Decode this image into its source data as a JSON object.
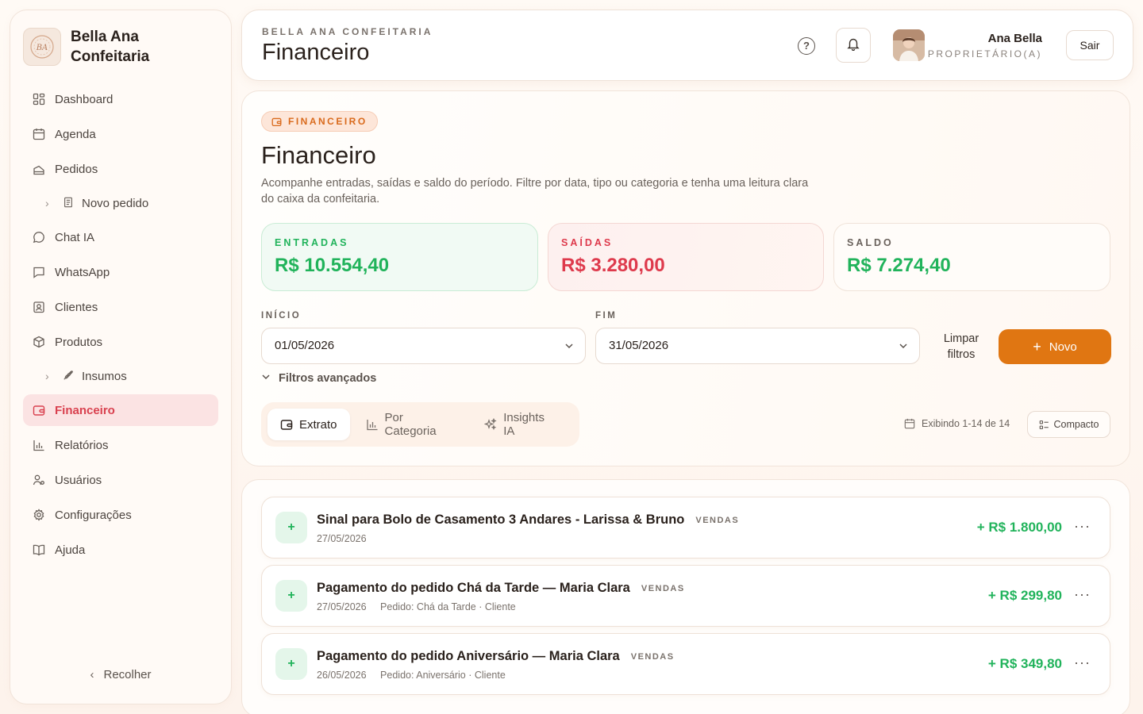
{
  "brand": {
    "name_line1": "Bella Ana",
    "name_line2": "Confeitaria"
  },
  "sidebar": {
    "items": [
      {
        "label": "Dashboard",
        "icon": "dashboard-icon"
      },
      {
        "label": "Agenda",
        "icon": "calendar-icon"
      },
      {
        "label": "Pedidos",
        "icon": "cake-icon"
      },
      {
        "label": "Novo pedido",
        "icon": "document-icon",
        "sub": true
      },
      {
        "label": "Chat IA",
        "icon": "chat-icon"
      },
      {
        "label": "WhatsApp",
        "icon": "message-icon"
      },
      {
        "label": "Clientes",
        "icon": "contact-icon"
      },
      {
        "label": "Produtos",
        "icon": "package-icon"
      },
      {
        "label": "Insumos",
        "icon": "wheat-icon",
        "sub": true
      },
      {
        "label": "Financeiro",
        "icon": "wallet-icon",
        "active": true
      },
      {
        "label": "Relatórios",
        "icon": "bar-chart-icon"
      },
      {
        "label": "Usuários",
        "icon": "users-icon"
      },
      {
        "label": "Configurações",
        "icon": "gear-icon"
      },
      {
        "label": "Ajuda",
        "icon": "book-icon"
      }
    ],
    "collapse_label": "Recolher"
  },
  "header": {
    "eyebrow": "BELLA ANA CONFEITARIA",
    "title": "Financeiro",
    "user_name": "Ana Bella",
    "user_role": "PROPRIETÁRIO(A)",
    "logout_label": "Sair"
  },
  "panel": {
    "chip": "FINANCEIRO",
    "title": "Financeiro",
    "description": "Acompanhe entradas, saídas e saldo do período. Filtre por data, tipo ou categoria e tenha uma leitura clara do caixa da confeitaria.",
    "stats": {
      "in_label": "ENTRADAS",
      "in_value": "R$ 10.554,40",
      "out_label": "SAÍDAS",
      "out_value": "R$ 3.280,00",
      "bal_label": "SALDO",
      "bal_value": "R$ 7.274,40"
    },
    "filters": {
      "start_label": "INÍCIO",
      "start_value": "01/05/2026",
      "end_label": "FIM",
      "end_value": "31/05/2026",
      "clear_label_1": "Limpar",
      "clear_label_2": "filtros",
      "new_label": "Novo",
      "advanced_label": "Filtros avançados"
    },
    "tabs": [
      {
        "label": "Extrato",
        "active": true
      },
      {
        "label": "Por Categoria"
      },
      {
        "label": "Insights IA"
      }
    ],
    "showing": "Exibindo 1-14 de 14",
    "compact_label": "Compacto"
  },
  "transactions": [
    {
      "sign": "+",
      "title": "Sinal para Bolo de Casamento 3 Andares - Larissa & Bruno",
      "category": "VENDAS",
      "date": "27/05/2026",
      "extra": "",
      "amount": "+ R$ 1.800,00"
    },
    {
      "sign": "+",
      "title": "Pagamento do pedido Chá da Tarde — Maria Clara",
      "category": "VENDAS",
      "date": "27/05/2026",
      "extra": "Pedido: Chá da Tarde · Cliente",
      "amount": "+ R$ 299,80"
    },
    {
      "sign": "+",
      "title": "Pagamento do pedido Aniversário — Maria Clara",
      "category": "VENDAS",
      "date": "26/05/2026",
      "extra": "Pedido: Aniversário · Cliente",
      "amount": "+ R$ 349,80"
    }
  ],
  "colors": {
    "accent": "#e07612",
    "income": "#21b35b",
    "expense": "#de3a4c",
    "active_nav": "#d9414f"
  }
}
